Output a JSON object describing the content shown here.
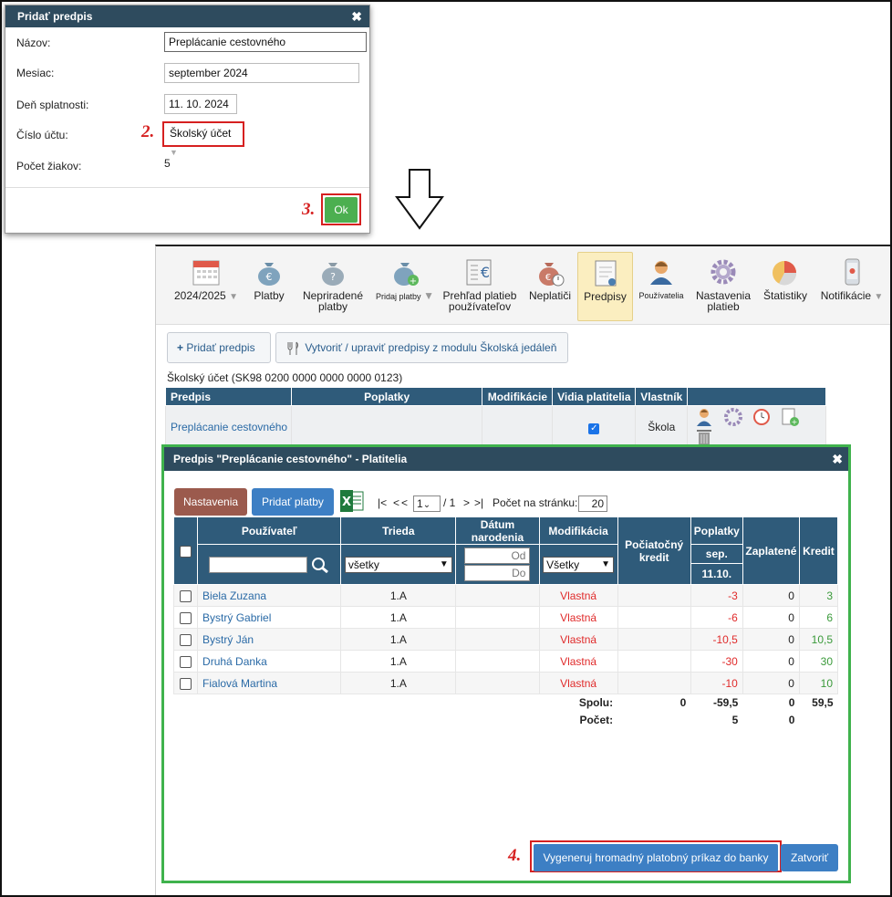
{
  "dialog1": {
    "title": "Pridať predpis",
    "name_label": "Názov:",
    "name_value": "Preplácanie cestovného",
    "month_label": "Mesiac:",
    "month_value": "september 2024",
    "due_label": "Deň splatnosti:",
    "due_value": "11. 10. 2024",
    "account_label": "Číslo účtu:",
    "account_value": "Školský účet",
    "students_label": "Počet žiakov:",
    "students_value": "5",
    "ok_label": "Ok"
  },
  "annotations": {
    "step2": "2.",
    "step3": "3.",
    "step4": "4."
  },
  "toolbar": {
    "items": [
      {
        "label": "2024/2025",
        "icon": "calendar-icon"
      },
      {
        "label": "Platby",
        "icon": "money-bag-icon"
      },
      {
        "label": "Nepriradené platby",
        "icon": "money-bag-question-icon"
      },
      {
        "label": "Pridaj platby",
        "icon": "money-bag-add-icon"
      },
      {
        "label": "Prehľad platieb používateľov",
        "icon": "euro-ledger-icon"
      },
      {
        "label": "Neplatiči",
        "icon": "money-bag-clock-icon"
      },
      {
        "label": "Predpisy",
        "icon": "document-icon"
      },
      {
        "label": "Používatelia",
        "icon": "user-icon"
      },
      {
        "label": "Nastavenia platieb",
        "icon": "gear-icon"
      },
      {
        "label": "Štatistiky",
        "icon": "pie-chart-icon"
      },
      {
        "label": "Notifikácie",
        "icon": "phone-icon"
      }
    ]
  },
  "actions": {
    "add_prescription": "Pridať predpis",
    "canteen": "Vytvoriť / upraviť predpisy z modulu Školská jedáleň"
  },
  "account_line": "Školský účet (SK98 0200 0000 0000 0000 0123)",
  "prescriptions": {
    "headers": [
      "Predpis",
      "Poplatky",
      "Modifikácie",
      "Vidia platitelia",
      "Vlastník"
    ],
    "row": {
      "name": "Preplácanie cestovného",
      "owner": "Škola"
    }
  },
  "dialog2": {
    "title": "Predpis \"Preplácanie cestovného\" - Platitelia",
    "settings_btn": "Nastavenia",
    "add_payments_btn": "Pridať platby",
    "pager": {
      "first": "|<",
      "prev_prev": "<",
      "prev": "<",
      "page": "1",
      "of": "/ 1",
      "next": ">",
      "last": ">|",
      "per_page_label": "Počet na stránku:",
      "per_page": "20"
    },
    "headers": {
      "user": "Používateľ",
      "class": "Trieda",
      "birth": "Dátum narodenia",
      "modification": "Modifikácia",
      "initial_credit": "Počiatočný kredit",
      "fees": "Poplatky",
      "fee_month": "sep.",
      "fee_date": "11.10.",
      "paid": "Zaplatené",
      "credit": "Kredit"
    },
    "filters": {
      "class": "všetky",
      "date_from": "Od",
      "date_to": "Do",
      "modification": "Všetky"
    },
    "rows": [
      {
        "user": "Biela Zuzana",
        "class": "1.A",
        "mod": "Vlastná",
        "fee": "-3",
        "paid": "0",
        "credit": "3"
      },
      {
        "user": "Bystrý Gabriel",
        "class": "1.A",
        "mod": "Vlastná",
        "fee": "-6",
        "paid": "0",
        "credit": "6"
      },
      {
        "user": "Bystrý Ján",
        "class": "1.A",
        "mod": "Vlastná",
        "fee": "-10,5",
        "paid": "0",
        "credit": "10,5"
      },
      {
        "user": "Druhá Danka",
        "class": "1.A",
        "mod": "Vlastná",
        "fee": "-30",
        "paid": "0",
        "credit": "30"
      },
      {
        "user": "Fialová Martina",
        "class": "1.A",
        "mod": "Vlastná",
        "fee": "-10",
        "paid": "0",
        "credit": "10"
      }
    ],
    "totals": {
      "label": "Spolu:",
      "initial": "0",
      "fee": "-59,5",
      "paid": "0",
      "credit": "59,5"
    },
    "counts": {
      "label": "Počet:",
      "fee": "5",
      "paid": "0"
    },
    "generate_btn": "Vygeneruj hromadný platobný príkaz do banky",
    "close_btn": "Zatvoriť"
  }
}
